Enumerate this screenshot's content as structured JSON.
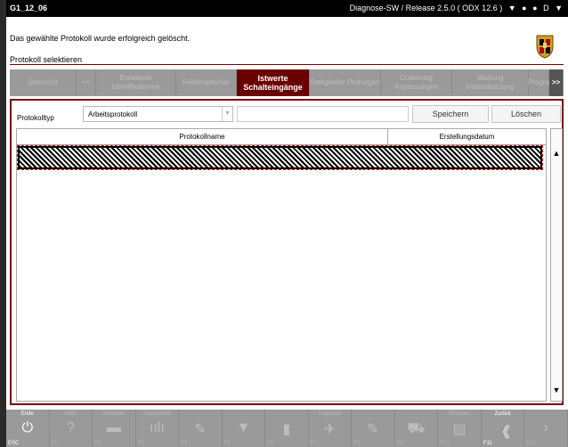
{
  "titlebar": {
    "id": "G1_12_06",
    "info": "Diagnose-SW /  Release  2.5.0  ( ODX  12.6 )",
    "lang": "D"
  },
  "message": "Das gewählte Protokoll wurde erfolgreich gelöscht.",
  "selection_label": "Protokoll selektieren",
  "tabs": [
    {
      "label": "Übersicht"
    },
    {
      "label": "<<"
    },
    {
      "label": "Erweiterte Identifikationen"
    },
    {
      "label": "Fehlerspeicher"
    },
    {
      "label": "Istwerte Schalteingänge"
    },
    {
      "label": "Stellglieder Prüfungen"
    },
    {
      "label": "Codierung Anpassungen"
    },
    {
      "label": "Wartung Instandsetzung"
    },
    {
      "label": "Progra"
    },
    {
      "label": ">>"
    }
  ],
  "form": {
    "protokolltyp_label": "Protokolltyp",
    "protokolltyp_value": "Arbeitsprotokoll",
    "save_label": "Speichern",
    "delete_label": "Löschen"
  },
  "grid": {
    "col1": "Protokollname",
    "col2": "Erstellungsdatum"
  },
  "fkeys": [
    {
      "label": "Ende",
      "key": "ESC",
      "icon": "⏻"
    },
    {
      "label": "Hilfe",
      "key": "F1",
      "icon": "?"
    },
    {
      "label": "Multiplex",
      "key": "F2",
      "icon": "▬"
    },
    {
      "label": "Datensätze",
      "key": "F3",
      "icon": "ıılı"
    },
    {
      "label": "",
      "key": "F4",
      "icon": "✎"
    },
    {
      "label": "",
      "key": "F5",
      "icon": "▼"
    },
    {
      "label": "",
      "key": "F6",
      "icon": "▮"
    },
    {
      "label": "Diagnose",
      "key": "F7",
      "icon": "✈"
    },
    {
      "label": "",
      "key": "F8",
      "icon": "✎"
    },
    {
      "label": "",
      "key": "F9",
      "icon": "⛟"
    },
    {
      "label": "Drucken",
      "key": "F10",
      "icon": "▤"
    },
    {
      "label": "Zurück",
      "key": "F11",
      "icon": "《"
    },
    {
      "label": "",
      "key": "F12",
      "icon": "›"
    }
  ]
}
